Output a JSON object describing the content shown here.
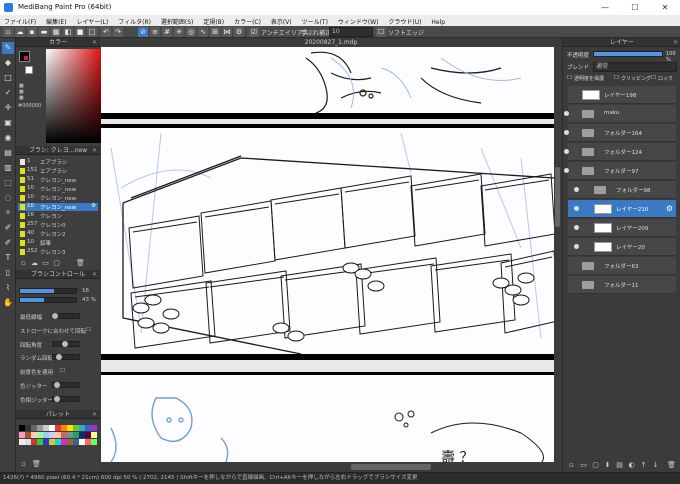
{
  "window": {
    "title": "MediBang Paint Pro (64bit)",
    "minimize": "—",
    "maximize": "☐",
    "close": "✕"
  },
  "menu": [
    "ファイル(F)",
    "編集(E)",
    "レイヤー(L)",
    "フィルタ(R)",
    "選択範囲(S)",
    "定規(B)",
    "カラー(C)",
    "表示(V)",
    "ツール(T)",
    "ウィンドウ(W)",
    "クラウド(U)",
    "Help"
  ],
  "toolbar": {
    "antialias_label": "アンチエイリアス",
    "stabilizer_label": "手ぶれ補正",
    "stabilizer_value": "10",
    "soft_edge_label": "ソフトエッジ"
  },
  "color_panel": {
    "title": "カラー",
    "hex": "#000000"
  },
  "brush_panel": {
    "title": "ブラシ: クレヨ…new",
    "items": [
      {
        "num": "1",
        "name": "エアブラシ",
        "color": "#e8e8e8"
      },
      {
        "num": "151",
        "name": "エアブラシ",
        "color": "#e0e020"
      },
      {
        "num": "51",
        "name": "クレヨン_new",
        "color": "#e0e020"
      },
      {
        "num": "10",
        "name": "クレヨン_new",
        "color": "#e0e020"
      },
      {
        "num": "10",
        "name": "クレヨン_new",
        "color": "#e0e020"
      },
      {
        "num": "10",
        "name": "クレヨン_new",
        "color": "#e0e020"
      },
      {
        "num": "16",
        "name": "クレヨン",
        "color": "#e0e020"
      },
      {
        "num": "257",
        "name": "クレヨン0",
        "color": "#e0e020"
      },
      {
        "num": "40",
        "name": "クレヨン2",
        "color": "#e0e020"
      },
      {
        "num": "10",
        "name": "鉛筆",
        "color": "#e0e020"
      },
      {
        "num": "252",
        "name": "クレヨン3",
        "color": "#e0e020"
      }
    ]
  },
  "brush_control": {
    "title": "ブラシコントロール",
    "size_value": "16",
    "opacity_value": "43 %",
    "size_fill": 0.6,
    "opacity_fill": 0.43,
    "options": [
      "最低線幅",
      "ストロークに合わせて回転",
      "回転角度",
      "ランダム回転",
      "前景色を適用",
      "色ジッター",
      "色相ジッター"
    ]
  },
  "palette": {
    "title": "パレット"
  },
  "canvas": {
    "tab_title": "20200827_1.mdp"
  },
  "layer_panel": {
    "title": "レイヤー",
    "opacity_label": "不透明度",
    "opacity_value": "100 %",
    "opacity_fill": 1.0,
    "blend_label": "ブレンド",
    "blend_value": "通常",
    "options": [
      "透明度を保護",
      "クリッピング",
      "ロック"
    ],
    "layers": [
      {
        "name": "レイヤー198",
        "kind": "layer",
        "indent": 0,
        "visible": false,
        "selected": false
      },
      {
        "name": "maku",
        "kind": "folder",
        "indent": 0,
        "visible": true,
        "selected": false
      },
      {
        "name": "フォルダー164",
        "kind": "folder",
        "indent": 0,
        "visible": true,
        "selected": false
      },
      {
        "name": "フォルダー124",
        "kind": "folder",
        "indent": 0,
        "visible": true,
        "selected": false
      },
      {
        "name": "フォルダー97",
        "kind": "folder",
        "indent": 0,
        "visible": true,
        "selected": false
      },
      {
        "name": "フォルダー98",
        "kind": "folder",
        "indent": 1,
        "visible": true,
        "selected": false
      },
      {
        "name": "レイヤー210",
        "kind": "layer",
        "indent": 1,
        "visible": true,
        "selected": true
      },
      {
        "name": "レイヤー209",
        "kind": "layer",
        "indent": 1,
        "visible": true,
        "selected": false
      },
      {
        "name": "レイヤー20",
        "kind": "layer",
        "indent": 1,
        "visible": true,
        "selected": false
      },
      {
        "name": "フォルダー63",
        "kind": "folder",
        "indent": 0,
        "visible": false,
        "selected": false
      },
      {
        "name": "フォルダー11",
        "kind": "folder",
        "indent": 0,
        "visible": false,
        "selected": false
      }
    ]
  },
  "status": "1426(?) * 4960 pixel  (60.4 * 21cm)  600 dpi  50 %  ( 2702, 2145 )  Shiftキーを押しながらで直線描画、Ctrl+Altキーを押しながら左右ドラッグでブラシサイズ変更",
  "colors": {
    "accent": "#3a79c4",
    "panel": "#3e3e3e",
    "blue_sketch": "#8fb4e6"
  }
}
